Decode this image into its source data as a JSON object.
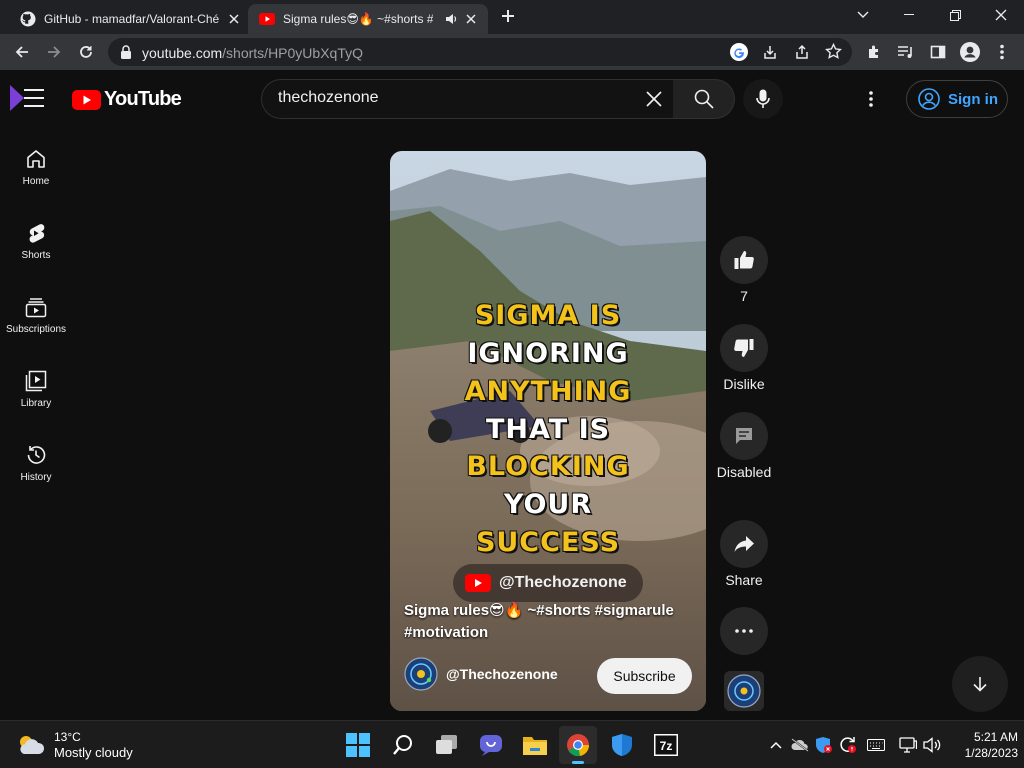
{
  "browser": {
    "tabs": [
      {
        "title": "GitHub - mamadfar/Valorant-Ché",
        "favicon": "github-icon",
        "active": false
      },
      {
        "title": "Sigma rules😎🔥 ~#shorts #",
        "favicon": "youtube-icon",
        "active": true
      }
    ],
    "url": {
      "host": "youtube.com",
      "path": "/shorts/HP0yUbXqTyQ"
    }
  },
  "youtube": {
    "logo_text": "YouTube",
    "search": {
      "value": "thechozenone",
      "placeholder": "Search"
    },
    "sign_in_label": "Sign in",
    "sidebar": [
      {
        "label": "Home",
        "icon": "home-icon"
      },
      {
        "label": "Shorts",
        "icon": "shorts-icon"
      },
      {
        "label": "Subscriptions",
        "icon": "subscriptions-icon"
      },
      {
        "label": "Library",
        "icon": "library-icon"
      },
      {
        "label": "History",
        "icon": "history-icon"
      }
    ],
    "short": {
      "caption_lines": [
        "SIGMA IS",
        "IGNORING",
        "ANYTHING",
        "THAT IS",
        "BLOCKING",
        "YOUR",
        "SUCCESS"
      ],
      "watermark": "@Thechozenone",
      "title": "Sigma rules😎🔥 ~#shorts #sigmarule #motivation",
      "channel": "@Thechozenone",
      "subscribe_label": "Subscribe"
    },
    "actions": {
      "like_count": "7",
      "dislike_label": "Dislike",
      "comments_label": "Disabled",
      "share_label": "Share"
    }
  },
  "taskbar": {
    "weather": {
      "temp": "13°C",
      "condition": "Mostly cloudy"
    },
    "time": "5:21 AM",
    "date": "1/28/2023"
  },
  "colors": {
    "yt_red": "#ff0000",
    "link_blue": "#3ea6ff",
    "caption_yellow": "#f3c21b"
  }
}
